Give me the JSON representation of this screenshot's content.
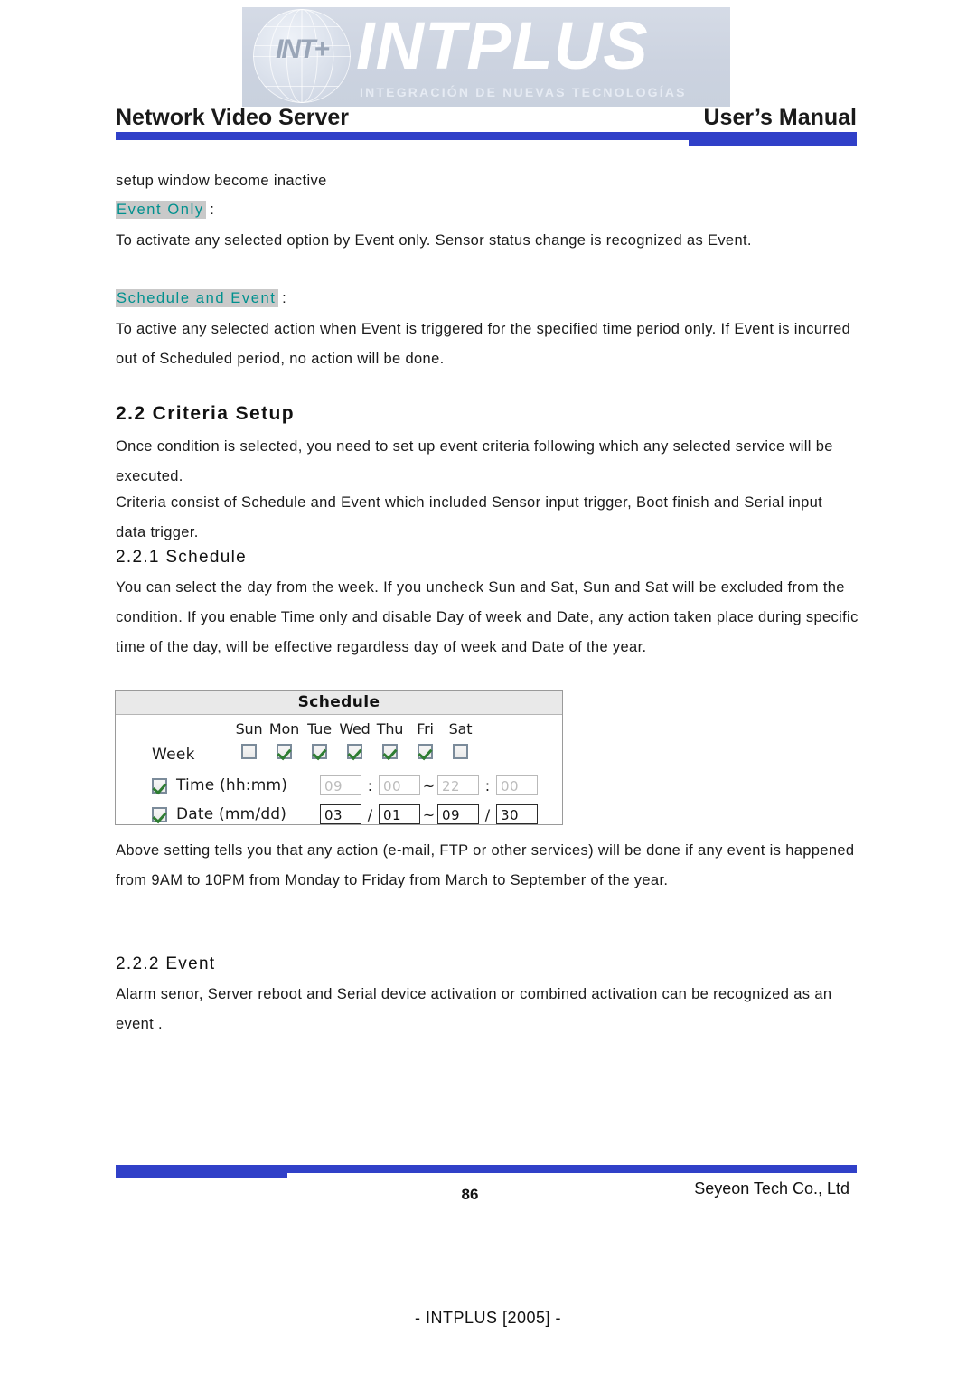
{
  "logo": {
    "monogram": "INT+",
    "wordmark": "INTPLUS",
    "tagline": "INTEGRACIÓN  DE  NUEVAS  TECNOLOGÍAS"
  },
  "header": {
    "left_title": "Network Video Server",
    "right_title": "User’s Manual"
  },
  "body": {
    "intro_line": "setup window become inactive",
    "term_event_only": "Event Only",
    "term_event_only_colon": " :",
    "para_event_only": "To activate any selected option by Event only. Sensor status change is recognized as Event.",
    "term_schedule_and_event": "Schedule and Event",
    "term_schedule_and_event_colon": " :",
    "para_schedule_and_event": "To active any selected action when Event is triggered for the specified time period only. If Event is incurred out of Scheduled period, no action will be done.",
    "section_2_2": "2.2 Criteria Setup",
    "para_2_2_a": "Once condition is selected, you need to set up event criteria following which any selected service will be executed.",
    "para_2_2_b": "Criteria consist of Schedule and  Event which included Sensor input trigger, Boot finish and Serial input data trigger.",
    "section_2_2_1": "2.2.1 Schedule",
    "para_2_2_1": "You can select the day from the week. If you uncheck Sun and Sat, Sun and Sat will be excluded from the condition. If you enable Time only and disable Day of week and Date, any action taken place during specific time of the day, will be effective regardless day of week and Date of the year.",
    "para_after_figure": "Above setting tells you that any action (e-mail, FTP or other services) will be done if any event is happened from 9AM to 10PM from Monday to Friday from March to September of the year.",
    "section_2_2_2": "2.2.2 Event",
    "para_2_2_2": "Alarm senor, Server reboot and Serial device activation or combined activation can be recognized as an event ."
  },
  "schedule_widget": {
    "title": "Schedule",
    "week_label": "Week",
    "days": [
      {
        "name": "Sun",
        "checked": false
      },
      {
        "name": "Mon",
        "checked": true
      },
      {
        "name": "Tue",
        "checked": true
      },
      {
        "name": "Wed",
        "checked": true
      },
      {
        "name": "Thu",
        "checked": true
      },
      {
        "name": "Fri",
        "checked": true
      },
      {
        "name": "Sat",
        "checked": false
      }
    ],
    "time_row": {
      "label": "Time (hh:mm)",
      "enabled_checkbox": true,
      "fields_disabled": true,
      "start_hh": "09",
      "start_mm": "00",
      "end_hh": "22",
      "end_mm": "00",
      "inner_sep": ":",
      "range_sep": "~"
    },
    "date_row": {
      "label": "Date (mm/dd)",
      "enabled_checkbox": true,
      "fields_disabled": false,
      "start_mm": "03",
      "start_dd": "01",
      "end_mm": "09",
      "end_dd": "30",
      "inner_sep": "/",
      "range_sep": "~"
    }
  },
  "footer": {
    "page_number": "86",
    "company": "Seyeon Tech Co., Ltd",
    "credit": "- INTPLUS [2005] -"
  },
  "colors": {
    "rule_blue": "#3040c8",
    "term_teal": "#00908e",
    "term_highlight": "#c9c9c9",
    "widget_header_bg": "#e9e9e9",
    "check_green": "#2e7d32"
  }
}
